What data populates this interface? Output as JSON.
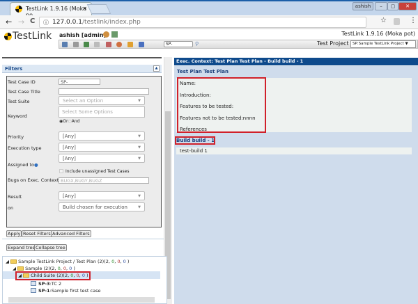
{
  "browser": {
    "tab_title": "TestLink 1.9.16 (Moka po",
    "tab_close": "✕",
    "window_user": "ashish",
    "url_host": "127.0.0.1",
    "url_path": "/testlink/index.php",
    "back": "←",
    "forward": "→",
    "reload": "C",
    "info": "ⓘ",
    "star": "☆",
    "menu": "⋮"
  },
  "header": {
    "logo": "TestLink",
    "user": "ashish [admin]",
    "version": "TestLink 1.9.16 (Moka pot)",
    "search_value": "SP-",
    "test_project_label": "Test Project",
    "test_project_value": "SP:Sample TestLink Project"
  },
  "filters": {
    "title": "Filters",
    "test_case_id_label": "Test Case ID",
    "test_case_id_value": "SP-",
    "test_case_title_label": "Test Case Title",
    "test_case_title_value": "",
    "test_suite_label": "Test Suite",
    "test_suite_placeholder": "Select an Option",
    "keyword_label": "Keyword",
    "keyword_placeholder": "Select Some Options",
    "or_label": "Or",
    "and_label": "And",
    "priority_label": "Priority",
    "priority_value": "[Any]",
    "execution_type_label": "Execution type",
    "execution_type_value": "[Any]",
    "assigned_to_label": "Assigned to",
    "assigned_to_value": "[Any]",
    "include_unassigned_label": "Include unassigned Test Cases",
    "bugs_label": "Bugs on Exec. Context",
    "bugs_placeholder": "BUGX,BUGY,BUGZ",
    "result_label": "Result",
    "result_value": "[Any]",
    "on_label": "on",
    "on_value": "Build chosen for execution",
    "apply": "Apply",
    "reset": "Reset Filters",
    "advanced": "Advanced Filters"
  },
  "tree": {
    "expand": "Expand tree",
    "collapse": "Collapse tree",
    "nodes": [
      {
        "label": "Sample TestLink Project / Test Plan (2)",
        "counts": [
          "2",
          "0",
          "0",
          "0"
        ]
      },
      {
        "label": "Sample (2)",
        "counts": [
          "2",
          "0",
          "0",
          "0"
        ]
      },
      {
        "label": "Child Suite (2)",
        "counts": [
          "2",
          "0",
          "0",
          "0"
        ]
      }
    ],
    "cases": [
      {
        "id": "SP-3",
        "name": ":TC 2"
      },
      {
        "id": "SP-1",
        "name": ":Sample first test case"
      }
    ]
  },
  "main": {
    "exec_context": "Exec. Context: Test Plan Test Plan - Build build - 1",
    "test_plan_title": "Test Plan Test Plan",
    "info": [
      "Name:",
      "Introduction:",
      "Features to be tested:",
      "Features not to be tested:nnnn",
      "References"
    ],
    "build_title": "Build build - 1",
    "build_desc": "test-build 1"
  },
  "colors": {
    "exec_header": "#0e4a8c",
    "panel": "#cfdcec",
    "highlight": "#d0202a"
  }
}
